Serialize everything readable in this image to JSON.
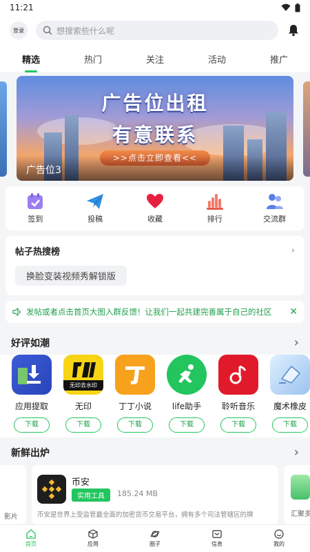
{
  "status": {
    "time": "11:21"
  },
  "header": {
    "login_label": "登录",
    "search_placeholder": "想搜索些什么呢"
  },
  "tabs": [
    {
      "label": "精选",
      "active": true
    },
    {
      "label": "热门"
    },
    {
      "label": "关注"
    },
    {
      "label": "活动"
    },
    {
      "label": "推广"
    }
  ],
  "banner": {
    "title_line1": "广告位出租",
    "title_line2": "有意联系",
    "cta": ">>点击立即查看<<",
    "caption": "广告位3"
  },
  "quick_actions": [
    {
      "label": "签到",
      "icon": "calendar-icon"
    },
    {
      "label": "投稿",
      "icon": "paper-plane-icon"
    },
    {
      "label": "收藏",
      "icon": "heart-icon"
    },
    {
      "label": "排行",
      "icon": "bar-chart-icon"
    },
    {
      "label": "交流群",
      "icon": "group-icon"
    }
  ],
  "hot_search": {
    "title": "帖子热搜榜",
    "tag": "换脸变装视频秀解锁版"
  },
  "notice": {
    "text": "发帖或者点击首页大图入群反馈！让我们一起共建完善属于自己的社区"
  },
  "good_reviews": {
    "title": "好评如潮",
    "download_label": "下载",
    "apps": [
      {
        "name": "应用提取"
      },
      {
        "name": "无印",
        "icon_text": "无印去水印"
      },
      {
        "name": "丁丁小说"
      },
      {
        "name": "life助手"
      },
      {
        "name": "聆听音乐"
      },
      {
        "name": "魔术橡皮"
      }
    ]
  },
  "fresh": {
    "title": "新鲜出炉",
    "left_peek": "影片",
    "card": {
      "name": "币安",
      "tag": "实用工具",
      "size": "185.24 MB",
      "desc": "币安是世界上受监管最全面的加密货币交易平台，拥有多个司法管辖区的牌"
    },
    "right_peek": "汇聚多"
  },
  "bottom_nav": [
    {
      "label": "首页",
      "active": true
    },
    {
      "label": "应用"
    },
    {
      "label": "圈子"
    },
    {
      "label": "信息"
    },
    {
      "label": "我的"
    }
  ],
  "colors": {
    "accent": "#22c55e"
  }
}
